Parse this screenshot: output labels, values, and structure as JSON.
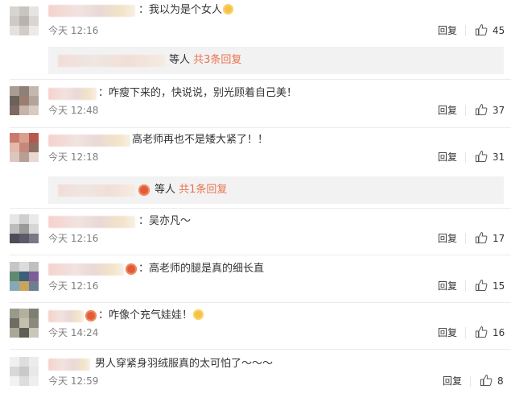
{
  "comments": [
    {
      "text": "：我以为是个女人",
      "emoji": "smile",
      "time": "今天 12:16",
      "reply": "回复",
      "likes": "45",
      "sub_reply": {
        "suffix": "等人",
        "count": "共3条回复"
      }
    },
    {
      "text": "：咋瘦下来的，快说说，别光顾着自己美！",
      "time": "今天 12:48",
      "reply": "回复",
      "likes": "37"
    },
    {
      "text": "高老师再也不是矮大紧了！！",
      "time": "今天 12:18",
      "reply": "回复",
      "likes": "31",
      "sub_reply": {
        "suffix": "等人",
        "count": "共1条回复"
      }
    },
    {
      "text": "：吴亦凡～",
      "time": "今天 12:16",
      "reply": "回复",
      "likes": "17"
    },
    {
      "text": "：高老师的腿是真的细长直",
      "time": "今天 12:16",
      "reply": "回复",
      "likes": "15"
    },
    {
      "text": "：咋像个充气娃娃！",
      "emoji": "surprised",
      "time": "今天 14:24",
      "reply": "回复",
      "likes": "16"
    },
    {
      "text": "男人穿紧身羽绒服真的太可怕了～～～",
      "time": "今天 12:59",
      "reply": "回复",
      "likes": "8"
    }
  ],
  "icons": {
    "like": "thumbs-up-icon",
    "badge": "vip-badge-icon"
  },
  "colors": {
    "reply_count": "#eb7350",
    "time": "#808080",
    "reply_bg": "#f2f2f2"
  }
}
